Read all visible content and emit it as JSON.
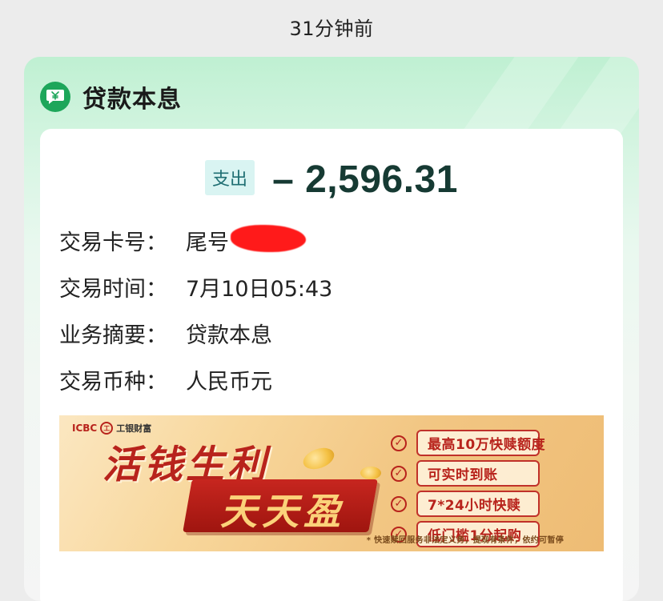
{
  "header": {
    "time_ago": "31分钟前"
  },
  "card": {
    "title": "贷款本息",
    "icon": "wallet-yuan-icon",
    "accent_color": "#1da65a"
  },
  "transaction": {
    "type_tag": "支出",
    "amount": "– 2,596.31",
    "rows": [
      {
        "label": "交易卡号：",
        "value": "尾号"
      },
      {
        "label": "交易时间：",
        "value": "7月10日05:43"
      },
      {
        "label": "业务摘要：",
        "value": "贷款本息"
      },
      {
        "label": "交易币种：",
        "value": "人民币元"
      }
    ]
  },
  "banner": {
    "brand": "ICBC",
    "brand_logo": "icbc-logo-icon",
    "brand_sub": "工银财富",
    "headline": "活钱生利",
    "sub_headline": "天天盈",
    "features": [
      "最高10万快赎额度",
      "可实时到账",
      "7*24小时快赎",
      "低门槛1分起购"
    ],
    "disclaimer": "* 快速赎回服务非法定义务，提现有条件，依约可暂停"
  }
}
